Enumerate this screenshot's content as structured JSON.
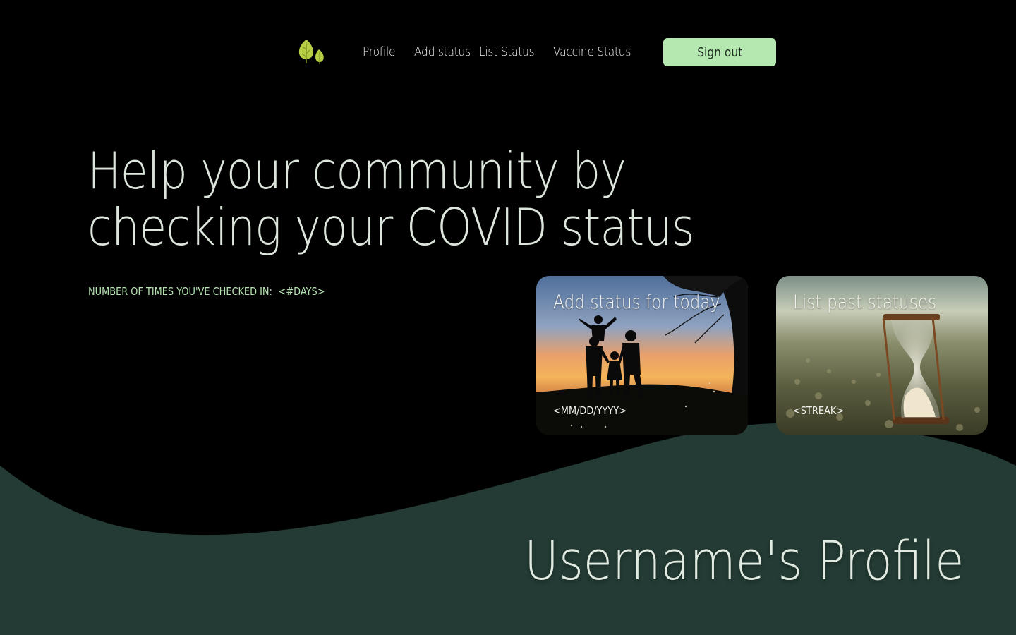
{
  "nav": {
    "logo_icon": "leaf-logo-icon",
    "links": [
      "Profile",
      "Add status",
      "List Status",
      "Vaccine Status"
    ],
    "signout_label": "Sign out"
  },
  "hero": {
    "line1": "Help your community by",
    "line2": "checking your COVID status"
  },
  "checkins": {
    "label": "NUMBER OF TIMES YOU'VE CHECKED IN:",
    "value": "<#DAYS>"
  },
  "cards": {
    "add": {
      "title": "Add status for today",
      "subtitle": "<MM/DD/YYYY>",
      "image": "family-silhouette-sunset"
    },
    "list": {
      "title": "List past statuses",
      "subtitle": "<STREAK>",
      "image": "hourglass-on-pebbles"
    }
  },
  "profile": {
    "title": "Username's Profile"
  },
  "colors": {
    "background": "#000000",
    "wave": "#233b34",
    "accent_button": "#b5e8b0",
    "accent_text": "#b5e2b0"
  }
}
